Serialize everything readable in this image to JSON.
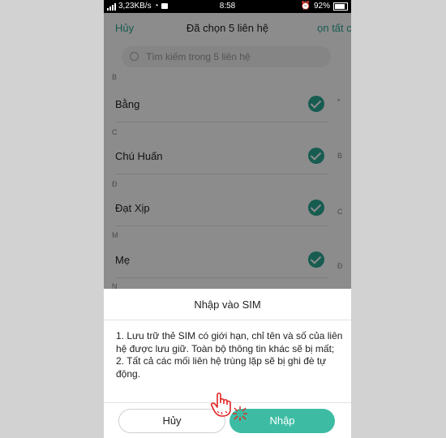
{
  "status_bar": {
    "speed": "3,23KB/s",
    "time": "8:58",
    "battery": "92%"
  },
  "header": {
    "cancel": "Hủy",
    "title": "Đã chọn 5 liên hệ",
    "select_all": "ọn tất cả"
  },
  "search": {
    "placeholder": "Tìm kiếm trong 5 liên hệ"
  },
  "contacts": [
    {
      "section": "B",
      "name": "Bằng"
    },
    {
      "section": "C",
      "name": "Chú Huấn"
    },
    {
      "section": "Đ",
      "name": "Đạt Xịp"
    },
    {
      "section": "M",
      "name": "Mẹ"
    }
  ],
  "next_section": "N",
  "index_letters": [
    "*",
    "B",
    "C",
    "Đ"
  ],
  "dialog": {
    "title": "Nhập vào SIM",
    "line1": "1. Lưu trữ thẻ SIM có giới hạn, chỉ tên và số của liên hệ được lưu giữ. Toàn bộ thông tin khác sẽ bị mất;",
    "line2": "2. Tất cả các mối liên hệ trùng lặp sẽ bị ghi đè tự động.",
    "cancel_button": "Hủy",
    "import_button": "Nhập"
  },
  "colors": {
    "accent": "#2aa894",
    "button_primary": "#3dbca3",
    "tap_hint": "#e02424"
  }
}
